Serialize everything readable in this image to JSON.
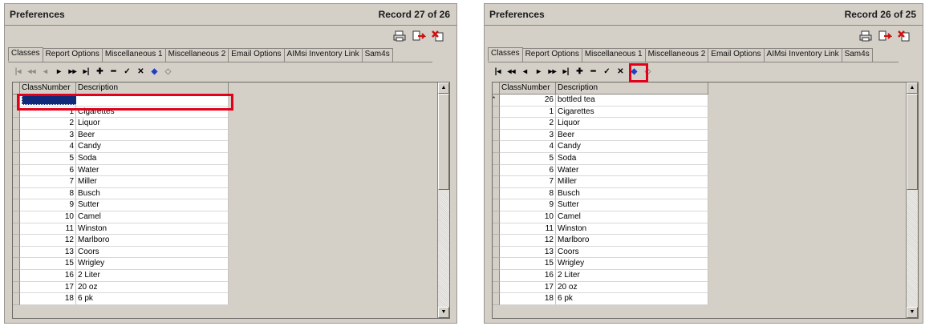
{
  "left": {
    "title": "Preferences",
    "record": "Record 27 of 26",
    "tabs": [
      "Classes",
      "Report Options",
      "Miscellaneous 1",
      "Miscellaneous 2",
      "Email Options",
      "AIMsi Inventory Link",
      "Sam4s"
    ],
    "columns": {
      "number": "ClassNumber",
      "description": "Description"
    },
    "new_row": {
      "number": "",
      "description": ""
    },
    "rows": [
      {
        "n": "1",
        "d": "Cigarettes"
      },
      {
        "n": "2",
        "d": "Liquor"
      },
      {
        "n": "3",
        "d": "Beer"
      },
      {
        "n": "4",
        "d": "Candy"
      },
      {
        "n": "5",
        "d": "Soda"
      },
      {
        "n": "6",
        "d": "Water"
      },
      {
        "n": "7",
        "d": "Miller"
      },
      {
        "n": "8",
        "d": "Busch"
      },
      {
        "n": "9",
        "d": "Sutter"
      },
      {
        "n": "10",
        "d": "Camel"
      },
      {
        "n": "11",
        "d": "Winston"
      },
      {
        "n": "12",
        "d": "Marlboro"
      },
      {
        "n": "13",
        "d": "Coors"
      },
      {
        "n": "15",
        "d": "Wrigley"
      },
      {
        "n": "16",
        "d": "2 Liter"
      },
      {
        "n": "17",
        "d": "20 oz"
      },
      {
        "n": "18",
        "d": "6 pk"
      }
    ]
  },
  "right": {
    "title": "Preferences",
    "record": "Record 26 of 25",
    "tabs": [
      "Classes",
      "Report Options",
      "Miscellaneous 1",
      "Miscellaneous 2",
      "Email Options",
      "AIMsi Inventory Link",
      "Sam4s"
    ],
    "columns": {
      "number": "ClassNumber",
      "description": "Description"
    },
    "new_row": {
      "marker": "*",
      "number": "26",
      "description": "bottled tea"
    },
    "rows": [
      {
        "n": "1",
        "d": "Cigarettes"
      },
      {
        "n": "2",
        "d": "Liquor"
      },
      {
        "n": "3",
        "d": "Beer"
      },
      {
        "n": "4",
        "d": "Candy"
      },
      {
        "n": "5",
        "d": "Soda"
      },
      {
        "n": "6",
        "d": "Water"
      },
      {
        "n": "7",
        "d": "Miller"
      },
      {
        "n": "8",
        "d": "Busch"
      },
      {
        "n": "9",
        "d": "Sutter"
      },
      {
        "n": "10",
        "d": "Camel"
      },
      {
        "n": "11",
        "d": "Winston"
      },
      {
        "n": "12",
        "d": "Marlboro"
      },
      {
        "n": "13",
        "d": "Coors"
      },
      {
        "n": "15",
        "d": "Wrigley"
      },
      {
        "n": "16",
        "d": "2 Liter"
      },
      {
        "n": "17",
        "d": "20 oz"
      },
      {
        "n": "18",
        "d": "6 pk"
      }
    ]
  },
  "nav_icons": [
    "first-icon",
    "prev-page-icon",
    "prev-icon",
    "next-icon",
    "next-page-icon",
    "last-icon",
    "add-icon",
    "delete-icon",
    "save-check-icon",
    "cancel-icon",
    "refresh-icon",
    "clear-icon"
  ],
  "top_icons": [
    "print-icon",
    "export-icon",
    "close-icon"
  ],
  "colors": {
    "highlight_box": "#e2001a",
    "panel_bg": "#d4d0c8",
    "selection": "#102a7a"
  }
}
